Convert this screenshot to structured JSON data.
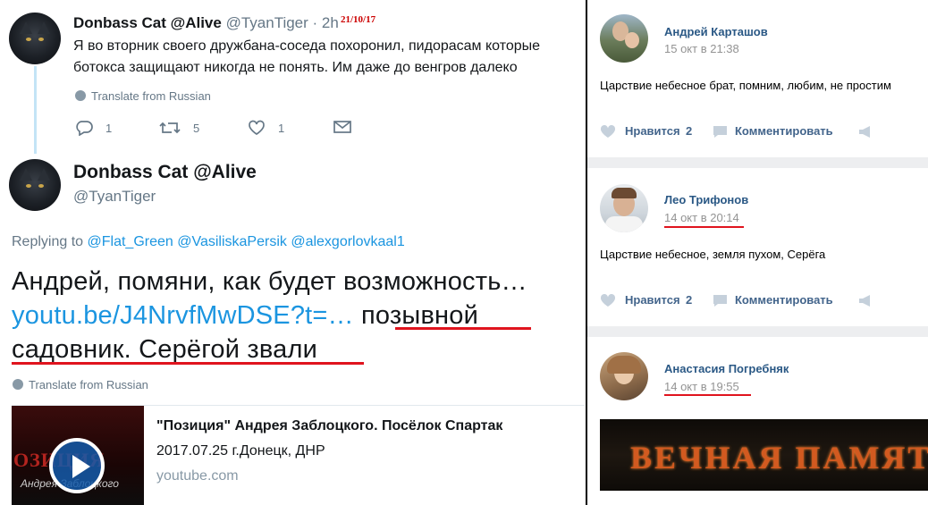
{
  "tweet1": {
    "display_name": "Donbass Cat @Alive",
    "handle": "@TyanTiger · 2h",
    "stamp": "21/10/17",
    "text": "Я во вторник своего дружбана-соседа похоронил, пидорасам которые ботокса защищают никогда не понять. Им даже до венгров далеко",
    "translate": "Translate from Russian",
    "actions": {
      "reply_count": "1",
      "retweet_count": "5",
      "like_count": "1"
    }
  },
  "tweet2": {
    "display_name": "Donbass Cat @Alive",
    "handle": "@TyanTiger",
    "replying_prefix": "Replying to ",
    "replying_to": [
      "@Flat_Green",
      "@VasiliskaPersik",
      "@alexgorlovkaal1"
    ],
    "text_part1": "Андрей, помяни, как будет возможность…",
    "link": "youtu.be/J4NrvfMwDSE?t=…",
    "text_part2": " позывной садовник. Серёгой звали",
    "translate": "Translate from Russian",
    "card": {
      "thumb_title": "ОЗИЦИЯ",
      "thumb_sub": "Андрея Заблоцкого",
      "title": "\"Позиция\" Андрея Заблоцкого. Посёлок Спартак",
      "description": "2017.07.25 г.Донецк, ДНР",
      "domain": "youtube.com"
    }
  },
  "vk": {
    "like_label": "Нравится",
    "comment_label": "Комментировать",
    "comments": [
      {
        "name": "Андрей Карташов",
        "date": "15 окт в 21:38",
        "text": "Царствие небесное брат, помним, любим, не простим",
        "likes": "2"
      },
      {
        "name": "Лео Трифонов",
        "date": "14 окт в 20:14",
        "text": "Царствие небесное, земля пухом, Серёга",
        "likes": "2"
      },
      {
        "name": "Анастасия Погребняк",
        "date": "14 окт в 19:55",
        "image_text": "ВЕЧНАЯ ПАМЯТЬ"
      }
    ]
  },
  "colors": {
    "twitter_blue": "#1b95e0",
    "vk_link": "#2a5885",
    "annotation_red": "#e0141e"
  }
}
